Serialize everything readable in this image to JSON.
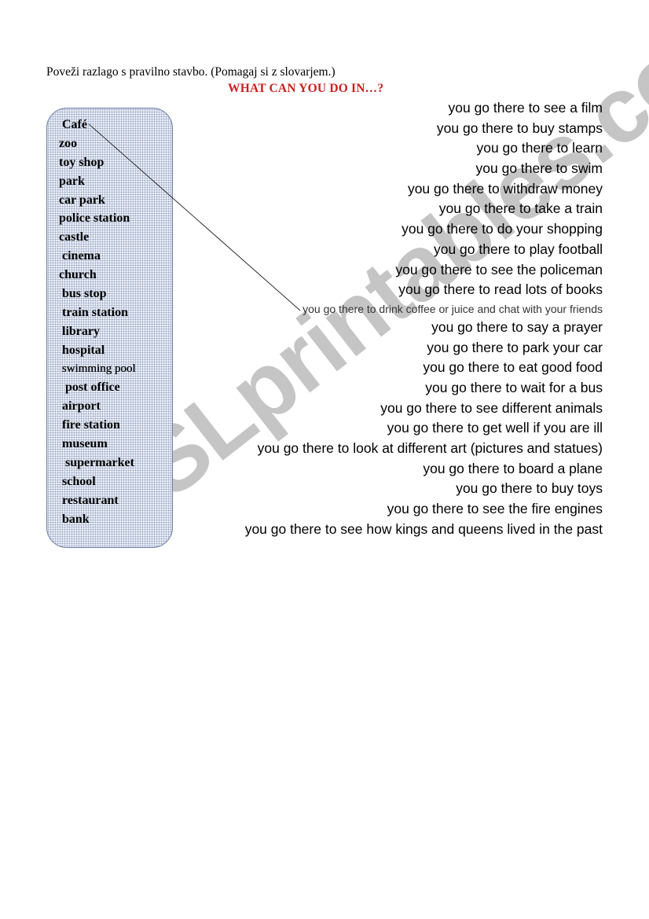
{
  "document": {
    "instruction": "Poveži razlago s pravilno stavbo. (Pomagaj si z slovarjem.)",
    "title": "WHAT CAN YOU DO IN…?",
    "title_color": "#cc1f1f",
    "watermark": "ESLprintables.com"
  },
  "places": [
    {
      "label": " Café",
      "small": false
    },
    {
      "label": "zoo",
      "small": false
    },
    {
      "label": "toy shop",
      "small": false
    },
    {
      "label": "park",
      "small": false
    },
    {
      "label": "car park",
      "small": false
    },
    {
      "label": "police station",
      "small": false
    },
    {
      "label": "castle",
      "small": false
    },
    {
      "label": " cinema",
      "small": false
    },
    {
      "label": "church",
      "small": false
    },
    {
      "label": " bus stop",
      "small": false
    },
    {
      "label": " train station",
      "small": false
    },
    {
      "label": " library",
      "small": false
    },
    {
      "label": " hospital",
      "small": false
    },
    {
      "label": " swimming pool",
      "small": true
    },
    {
      "label": "  post office",
      "small": false
    },
    {
      "label": " airport",
      "small": false
    },
    {
      "label": " fire station",
      "small": false
    },
    {
      "label": " museum",
      "small": false
    },
    {
      "label": "  supermarket",
      "small": false
    },
    {
      "label": " school",
      "small": false
    },
    {
      "label": " restaurant",
      "small": false
    },
    {
      "label": " bank",
      "small": false
    }
  ],
  "definitions": [
    {
      "text": "you go there to see a film",
      "small": false
    },
    {
      "text": "you go there to buy stamps",
      "small": false
    },
    {
      "text": "you go there to learn",
      "small": false
    },
    {
      "text": "you go there to swim",
      "small": false
    },
    {
      "text": "you go there to withdraw money",
      "small": false
    },
    {
      "text": "you go there to take a train",
      "small": false
    },
    {
      "text": "you go there to do your shopping",
      "small": false
    },
    {
      "text": "you go there to play football",
      "small": false
    },
    {
      "text": "you go there to see the policeman",
      "small": false
    },
    {
      "text": "you go there to read lots of books",
      "small": false
    },
    {
      "text": "you go there to drink coffee or juice and chat with your friends",
      "small": true
    },
    {
      "text": "you go there to say a prayer",
      "small": false
    },
    {
      "text": "you go there to park your car",
      "small": false
    },
    {
      "text": "you go there to eat good food",
      "small": false
    },
    {
      "text": "you go there to wait for a bus",
      "small": false
    },
    {
      "text": "you go there to see different animals",
      "small": false
    },
    {
      "text": "you go there to get well if you are ill",
      "small": false
    },
    {
      "text": "you go there to look at different art (pictures and statues)",
      "small": false
    },
    {
      "text": "you go there to board a plane",
      "small": false
    },
    {
      "text": "you go there to buy toys",
      "small": false
    },
    {
      "text": "you go there to see the fire engines",
      "small": false
    },
    {
      "text": "you go there to see how kings and queens lived in the past",
      "small": false
    }
  ],
  "example_match": {
    "place_index": 0,
    "definition_index": 10
  }
}
